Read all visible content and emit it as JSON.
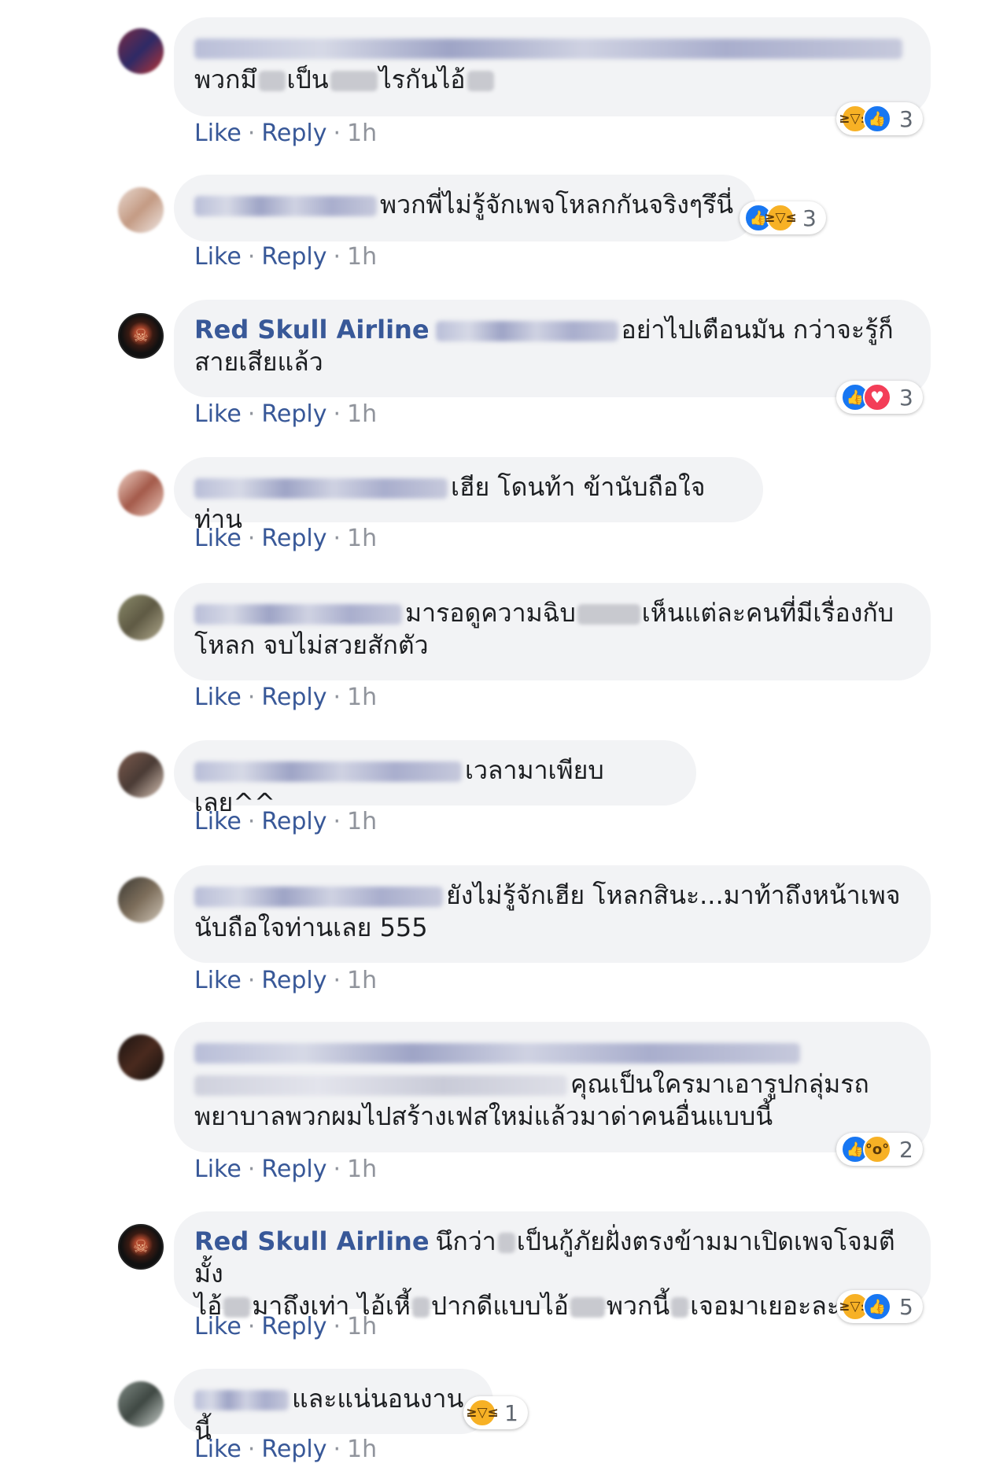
{
  "actions": {
    "like": "Like",
    "reply": "Reply",
    "separator": "·",
    "time": "1h"
  },
  "colors": {
    "bubble": "#f2f3f5",
    "link": "#385898",
    "meta": "#90949c",
    "like": "#1877f2",
    "love": "#f33e58",
    "haha": "#f7b125"
  },
  "comments": [
    {
      "author": "",
      "text_line1": "",
      "text_line2": "พวกมึ",
      "text_line2b": "เป็น",
      "text_line2c": "ไรกันไอ้",
      "reactions": [
        "haha-icon",
        "like-icon"
      ],
      "reaction_count": "3"
    },
    {
      "author": "",
      "text": "พวกพี่ไม่รู้จักเพจโหลกกันจริงๆรึนี่",
      "reactions": [
        "like-icon",
        "haha-icon"
      ],
      "reaction_count": "3"
    },
    {
      "author": "Red Skull Airline",
      "text_a": "อย่าไปเตือนมัน กว่าจะรู้ก็",
      "text_b": "สายเสียแล้ว",
      "reactions": [
        "like-icon",
        "love-icon"
      ],
      "reaction_count": "3"
    },
    {
      "author": "",
      "text": "เฮีย โดนท้า ข้านับถือใจท่าน"
    },
    {
      "author": "",
      "text_a": "มารอดูความฉิบ",
      "text_b": "เห็นแต่ละคนที่มีเรื่องกับ",
      "text_c": "โหลก จบไม่สวยสักตัว"
    },
    {
      "author": "",
      "text": "เวลามาเพียบเลย^^"
    },
    {
      "author": "",
      "text_a": "ยังไม่รู้จักเฮีย โหลกสินะ...มาท้าถึงหน้าเพจ",
      "text_b": "นับถือใจท่านเลย 555"
    },
    {
      "author": "",
      "text_a": "คุณเป็นใครมาเอารูปกลุ่มรถ",
      "text_b": "พยาบาลพวกผมไปสร้างเฟสใหม่แล้วมาด่าคนอื่นแบบนี้",
      "reactions": [
        "like-icon",
        "wow-icon"
      ],
      "reaction_count": "2"
    },
    {
      "author": "Red Skull Airline",
      "text_a": "นึกว่า",
      "text_b": "เป็นกู้ภัยฝั่งตรงข้ามมาเปิดเพจโจมตีมั้ง",
      "text_c": "ไอ้",
      "text_d": "มาถึงเท่า ไอ้เหี้",
      "text_e": "ปากดีแบบไอ้",
      "text_f": "พวกนี้",
      "text_g": "เจอมาเยอะละ",
      "reactions": [
        "haha-icon",
        "like-icon"
      ],
      "reaction_count": "5"
    },
    {
      "author": "",
      "text": "และแน่นอนงานนี้",
      "reactions": [
        "haha-icon"
      ],
      "reaction_count": "1"
    }
  ]
}
